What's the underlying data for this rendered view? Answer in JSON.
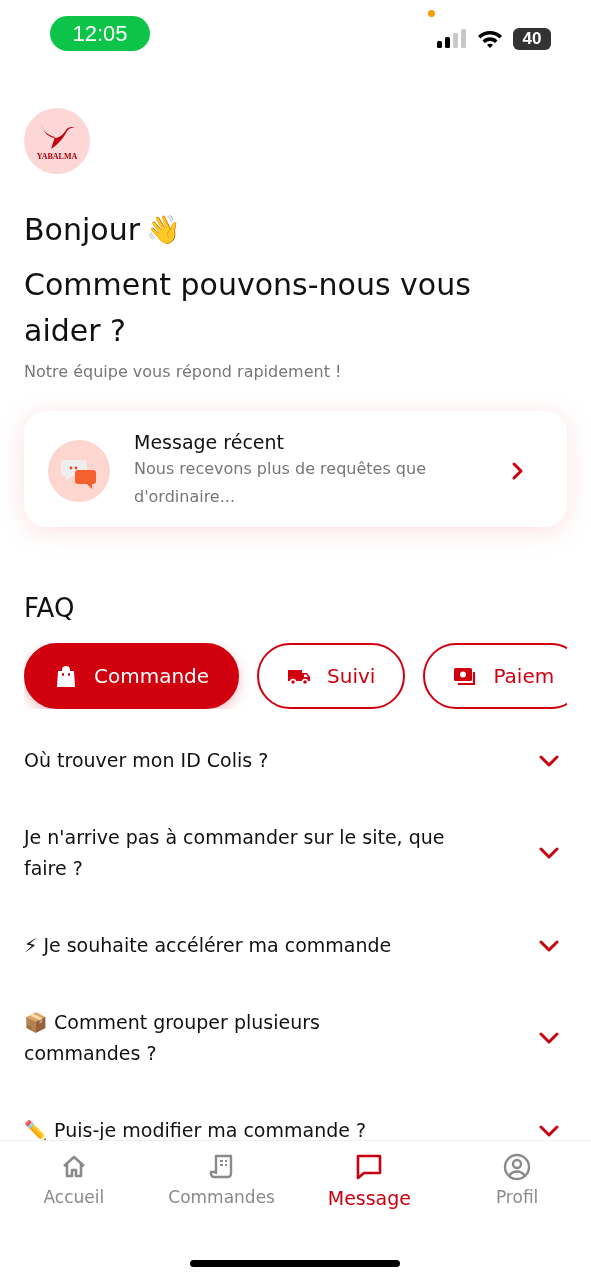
{
  "status_bar": {
    "time": "12:05",
    "battery": "40"
  },
  "logo": {
    "text": "YABALMA"
  },
  "greeting": {
    "title": "Bonjour",
    "emoji": "👋"
  },
  "heading": "Comment pouvons-nous vous aider ?",
  "subtitle": "Notre équipe vous répond rapidement !",
  "recent_message": {
    "title": "Message récent",
    "preview": "Nous recevons plus de requêtes que d'ordinaire..."
  },
  "faq": {
    "title": "FAQ",
    "categories": [
      {
        "label": "Commande",
        "kind": "bag",
        "selected": true
      },
      {
        "label": "Suivi",
        "kind": "truck",
        "selected": false
      },
      {
        "label": "Paiem",
        "kind": "money",
        "selected": false
      }
    ],
    "questions": [
      {
        "text": "Où trouver mon ID Colis ?",
        "expanded": false
      },
      {
        "text": "Je n'arrive pas à commander sur le site, que faire ?",
        "expanded": false
      },
      {
        "text": "⚡ Je souhaite accélérer ma commande",
        "expanded": false
      },
      {
        "text": "📦 Comment grouper plusieurs commandes ?",
        "expanded": false
      },
      {
        "text": "✏️ Puis-je modifier ma commande ?",
        "expanded": false
      }
    ]
  },
  "tab_bar": [
    {
      "label": "Accueil",
      "kind": "home",
      "selected": false
    },
    {
      "label": "Commandes",
      "kind": "receipt",
      "selected": false
    },
    {
      "label": "Message",
      "kind": "chat",
      "selected": true
    },
    {
      "label": "Profil",
      "kind": "profile",
      "selected": false
    }
  ]
}
